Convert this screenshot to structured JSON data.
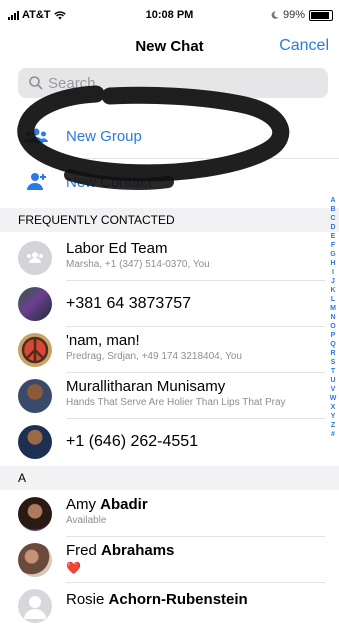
{
  "status": {
    "carrier": "AT&T",
    "time": "10:08 PM",
    "battery": "99%"
  },
  "nav": {
    "title": "New Chat",
    "cancel": "Cancel"
  },
  "search": {
    "placeholder": "Search"
  },
  "actions": {
    "new_group": "New Group",
    "new_contact": "New Contact"
  },
  "sections": {
    "frequent": "FREQUENTLY CONTACTED",
    "a": "A"
  },
  "frequent": [
    {
      "name": "Labor Ed Team",
      "sub": "Marsha, +1 (347) 514-0370, You"
    },
    {
      "name": "+381 64 3873757"
    },
    {
      "name": "'nam, man!",
      "sub": "Predrag, Srdjan, +49 174 3218404, You"
    },
    {
      "name": "Murallitharan Munisamy",
      "sub": "Hands That Serve Are Holier Than Lips That Pray"
    },
    {
      "name": "+1 (646) 262-4551"
    }
  ],
  "contacts_a": [
    {
      "first": "Amy",
      "last": "Abadir",
      "sub": "Available"
    },
    {
      "first": "Fred",
      "last": "Abrahams",
      "sub": "❤️"
    },
    {
      "first": "Rosie",
      "last": "Achorn-Rubenstein"
    }
  ],
  "index_letters": [
    "A",
    "B",
    "C",
    "D",
    "E",
    "F",
    "G",
    "H",
    "I",
    "J",
    "K",
    "L",
    "M",
    "N",
    "O",
    "P",
    "Q",
    "R",
    "S",
    "T",
    "U",
    "V",
    "W",
    "X",
    "Y",
    "Z",
    "#"
  ],
  "colors": {
    "accent": "#2a7ae2",
    "section_bg": "#f2f2f4",
    "heart": "#e0353c"
  }
}
